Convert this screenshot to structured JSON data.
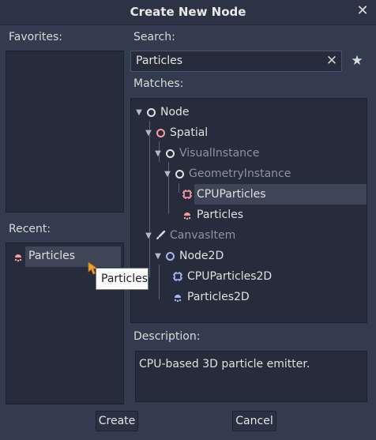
{
  "dialog": {
    "title": "Create New Node",
    "close_icon": "close-icon"
  },
  "favorites": {
    "label": "Favorites:"
  },
  "recent": {
    "label": "Recent:",
    "items": [
      {
        "label": "Particles",
        "icon": "particles-3d-icon",
        "icon_color": "#fc9c9c"
      }
    ]
  },
  "search": {
    "label": "Search:",
    "value": "Particles",
    "clear_icon": "clear-icon",
    "favorite_icon": "star-icon"
  },
  "matches": {
    "label": "Matches:",
    "tree": [
      {
        "label": "Node",
        "expanded": true,
        "icon": "node-icon",
        "icon_color": "#e0e0e0",
        "dim": false,
        "selected": false
      },
      {
        "label": "Spatial",
        "expanded": true,
        "icon": "spatial-icon",
        "icon_color": "#fc9c9c",
        "dim": false,
        "selected": false
      },
      {
        "label": "VisualInstance",
        "expanded": true,
        "icon": "visual-instance-icon",
        "icon_color": "#e0e0e0",
        "dim": true,
        "selected": false
      },
      {
        "label": "GeometryInstance",
        "expanded": true,
        "icon": "geometry-instance-icon",
        "icon_color": "#e0e0e0",
        "dim": true,
        "selected": false
      },
      {
        "label": "CPUParticles",
        "expanded": false,
        "icon": "cpu-particles-icon",
        "icon_color": "#fc9c9c",
        "dim": false,
        "selected": true
      },
      {
        "label": "Particles",
        "expanded": false,
        "icon": "particles-3d-icon",
        "icon_color": "#fc9c9c",
        "dim": false,
        "selected": false
      },
      {
        "label": "CanvasItem",
        "expanded": true,
        "icon": "canvas-item-icon",
        "icon_color": "#e0e0e0",
        "dim": true,
        "selected": false
      },
      {
        "label": "Node2D",
        "expanded": true,
        "icon": "node2d-icon",
        "icon_color": "#a5b7f3",
        "dim": false,
        "selected": false
      },
      {
        "label": "CPUParticles2D",
        "expanded": false,
        "icon": "cpu-particles-2d-icon",
        "icon_color": "#a5b7f3",
        "dim": false,
        "selected": false
      },
      {
        "label": "Particles2D",
        "expanded": false,
        "icon": "particles-2d-icon",
        "icon_color": "#a5b7f3",
        "dim": false,
        "selected": false
      }
    ]
  },
  "description": {
    "label": "Description:",
    "text": "CPU-based 3D particle emitter."
  },
  "tooltip": {
    "text": "Particles"
  },
  "buttons": {
    "create": "Create",
    "cancel": "Cancel"
  }
}
